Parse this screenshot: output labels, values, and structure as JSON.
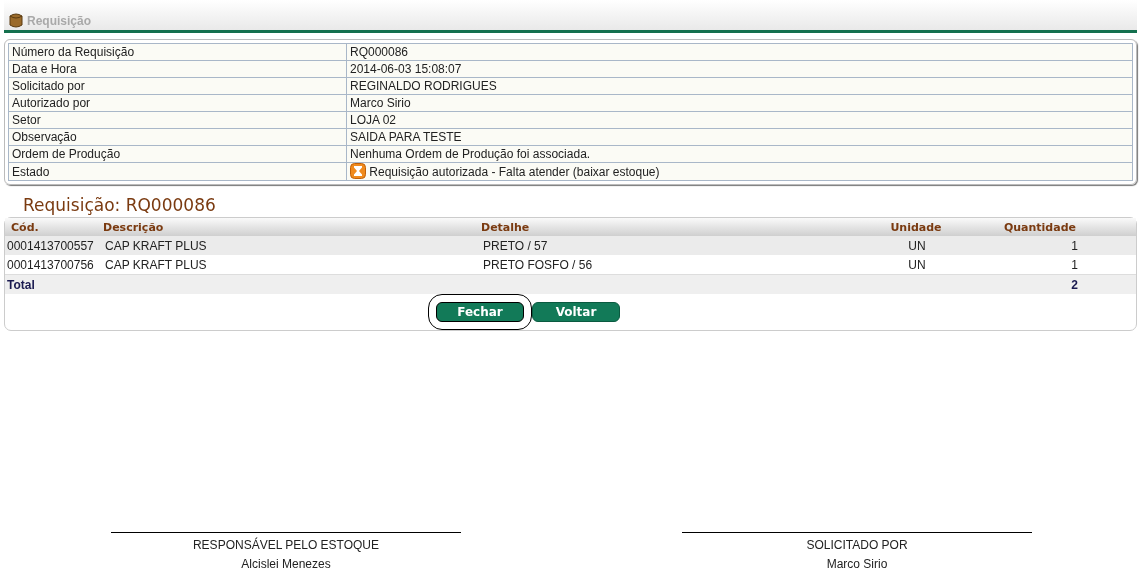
{
  "header": {
    "title": "Requisição"
  },
  "info": [
    {
      "label": "Número da Requisição",
      "value": "RQ000086"
    },
    {
      "label": "Data e Hora",
      "value": "2014-06-03 15:08:07"
    },
    {
      "label": "Solicitado por",
      "value": "REGINALDO RODRIGUES"
    },
    {
      "label": "Autorizado por",
      "value": "Marco Sirio"
    },
    {
      "label": "Setor",
      "value": "LOJA 02"
    },
    {
      "label": "Observação",
      "value": "SAIDA PARA TESTE"
    },
    {
      "label": "Ordem de Produção",
      "value": "Nenhuma Ordem de Produção foi associada."
    },
    {
      "label": "Estado",
      "value": "Requisição autorizada - Falta atender (baixar estoque)",
      "kind": "status"
    }
  ],
  "items_title": "Requisição: RQ000086",
  "table": {
    "columns": [
      "Cód.",
      "Descrição",
      "Detalhe",
      "Unidade",
      "Quantidade"
    ],
    "rows": [
      [
        "0001413700557",
        "CAP KRAFT PLUS",
        "PRETO / 57",
        "UN",
        "1"
      ],
      [
        "0001413700756",
        "CAP KRAFT PLUS",
        "PRETO FOSFO / 56",
        "UN",
        "1"
      ]
    ],
    "total": {
      "label": "Total",
      "value": "2"
    }
  },
  "buttons": [
    {
      "label": "Fechar",
      "focused": true
    },
    {
      "label": "Voltar",
      "focused": false
    }
  ],
  "signatures": [
    {
      "role": "RESPONSÁVEL PELO ESTOQUE",
      "name": "Alcislei Menezes"
    },
    {
      "role": "SOLICITADO POR",
      "name": "Marco Sirio"
    }
  ]
}
